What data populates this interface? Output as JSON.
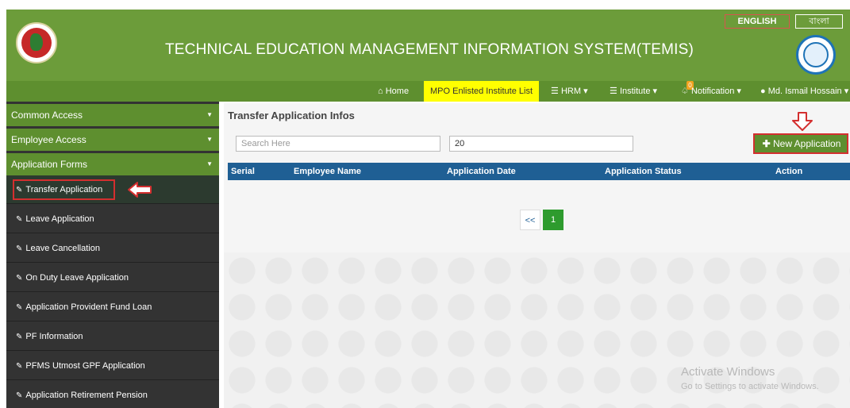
{
  "header": {
    "title": "TECHNICAL EDUCATION MANAGEMENT INFORMATION SYSTEM(TEMIS)",
    "lang_english": "ENGLISH",
    "lang_bangla": "বাংলা"
  },
  "nav": {
    "home": "Home",
    "mpo": "MPO Enlisted Institute List",
    "hrm": "HRM",
    "institute": "Institute",
    "notification": "Notification",
    "notification_count": "0",
    "user": "Md. Ismail Hossain"
  },
  "sidebar": {
    "sections": [
      {
        "label": "Common Access"
      },
      {
        "label": "Employee Access"
      },
      {
        "label": "Application Forms"
      }
    ],
    "items": [
      {
        "label": "Transfer Application"
      },
      {
        "label": "Leave Application"
      },
      {
        "label": "Leave Cancellation"
      },
      {
        "label": "On Duty Leave Application"
      },
      {
        "label": "Application Provident Fund Loan"
      },
      {
        "label": "PF Information"
      },
      {
        "label": "PFMS Utmost GPF Application"
      },
      {
        "label": "Application Retirement Pension"
      }
    ]
  },
  "main": {
    "title": "Transfer Application Infos",
    "search_placeholder": "Search Here",
    "page_size": "20",
    "new_button": "New Application",
    "columns": [
      "Serial",
      "Employee Name",
      "Application Date",
      "Application Status",
      "Action"
    ],
    "pager_prev": "<<",
    "pager_current": "1"
  },
  "watermark": {
    "line1": "Activate Windows",
    "line2": "Go to Settings to activate Windows."
  },
  "colors": {
    "header_green": "#6c9c3a",
    "nav_green": "#5e8f2f",
    "table_header_blue": "#1f5f94",
    "highlight_red": "#d32f2f",
    "mpo_yellow": "#ffff00"
  }
}
